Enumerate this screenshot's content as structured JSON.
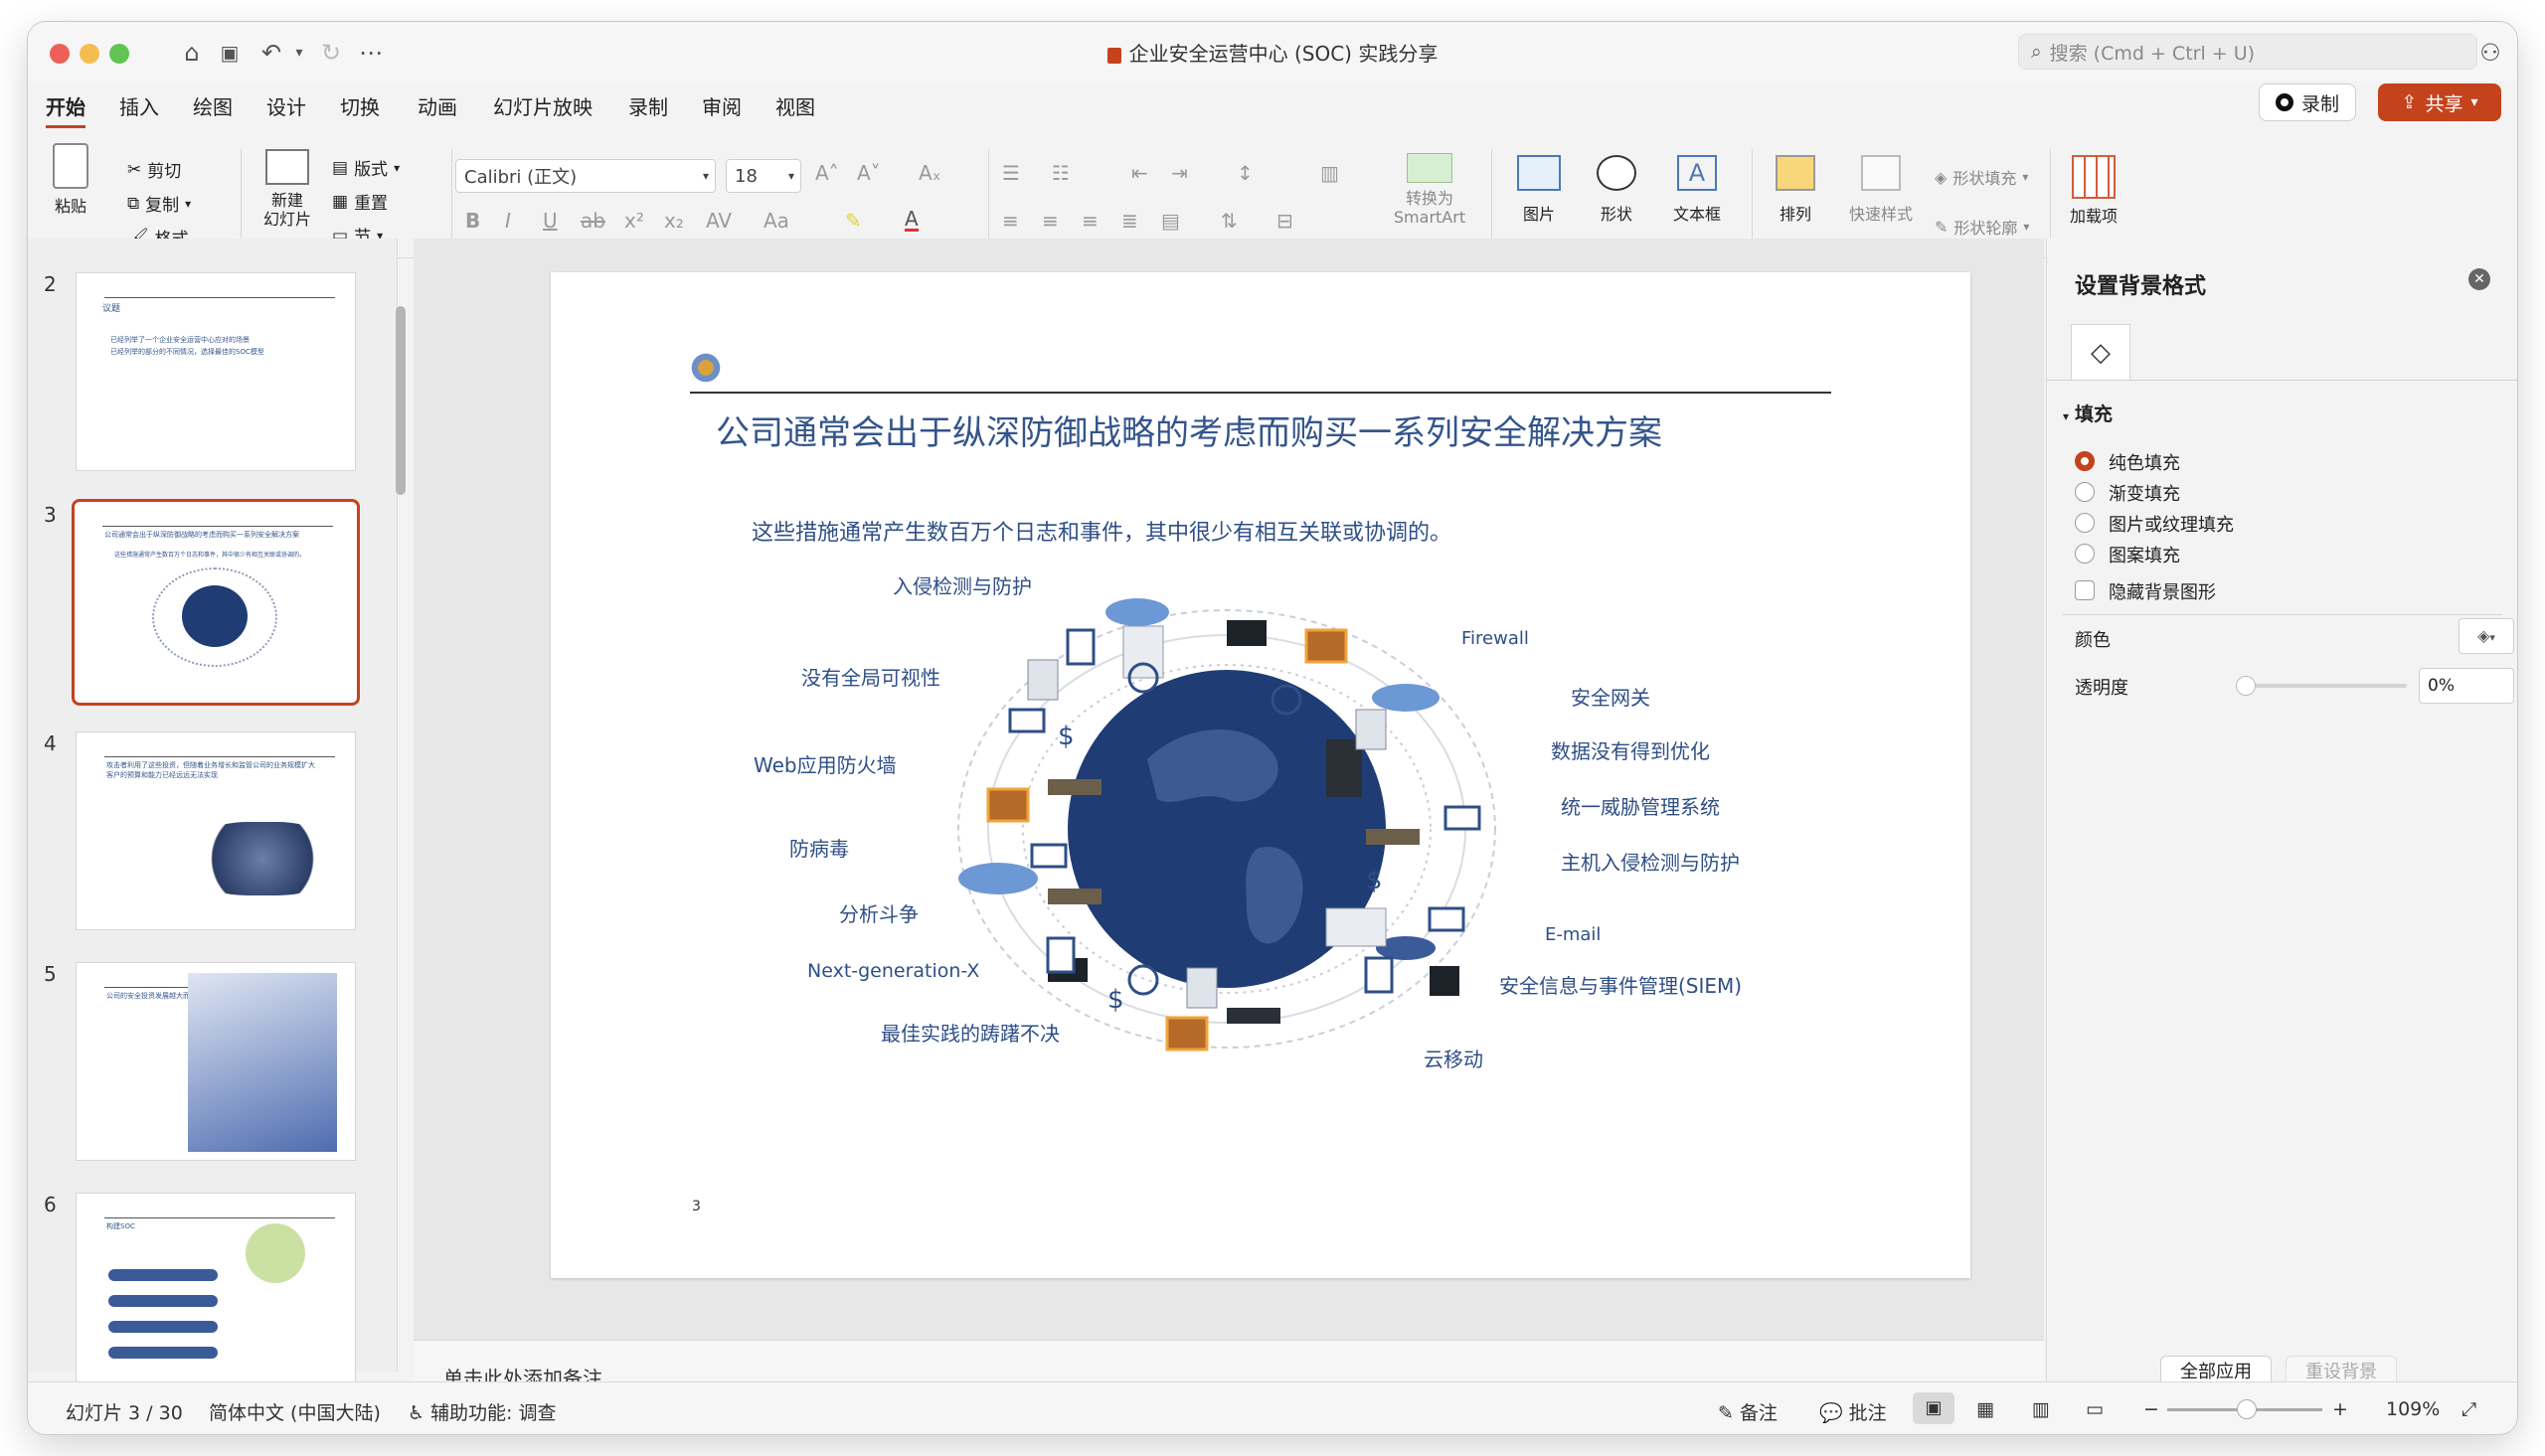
{
  "window": {
    "title": "企业安全运营中心 (SOC) 实践分享",
    "search_placeholder": "搜索 (Cmd + Ctrl + U)"
  },
  "tabs": [
    "开始",
    "插入",
    "绘图",
    "设计",
    "切换",
    "动画",
    "幻灯片放映",
    "录制",
    "审阅",
    "视图"
  ],
  "header_buttons": {
    "record": "录制",
    "share": "共享"
  },
  "ribbon": {
    "paste": "粘贴",
    "cut": "剪切",
    "copy": "复制",
    "format": "格式",
    "new_slide": "新建\n幻灯片",
    "layout": "版式",
    "reset": "重置",
    "section": "节",
    "font_name": "Calibri (正文)",
    "font_size": "18",
    "convert_smartart": "转换为\nSmartArt",
    "picture": "图片",
    "shape": "形状",
    "textbox": "文本框",
    "arrange": "排列",
    "quick_styles": "快速样式",
    "shape_fill": "形状填充",
    "shape_outline": "形状轮廓",
    "addins": "加载项"
  },
  "thumbnails": [
    {
      "number": "2",
      "title": "议题",
      "lines": [
        "已经列举了一个企业安全运营中心应对的场景",
        "已经列举的部分的不同情况，选择最佳的SOC模型"
      ]
    },
    {
      "number": "3",
      "title": "公司通常会出于纵深防御战略的考虑而购买一系列安全解决方案",
      "lines": [
        "这些措施通常产生数百万个日志和事件，其中很少有相互关联或协调的。"
      ]
    },
    {
      "number": "4",
      "title": "攻击者利用了这些投资，但随着业务增长和监管公司的业务规模扩大",
      "lines": [
        "客户的预算和能力已经远远无法实现"
      ]
    },
    {
      "number": "5",
      "title": "公司的安全投资发展越大而越",
      "lines": []
    },
    {
      "number": "6",
      "title": "构建SOC",
      "lines": []
    }
  ],
  "slide": {
    "title": "公司通常会出于纵深防御战略的考虑而购买一系列安全解决方案",
    "subtitle": "这些措施通常产生数百万个日志和事件，其中很少有相互关联或协调的。",
    "page_number": "3",
    "labels_left": [
      "入侵检测与防护",
      "没有全局可视性",
      "Web应用防火墙",
      "防病毒",
      "分析斗争",
      "Next-generation-X",
      "最佳实践的踌躇不决"
    ],
    "labels_right": [
      "Firewall",
      "安全网关",
      "数据没有得到优化",
      "统一威胁管理系统",
      "主机入侵检测与防护",
      "E-mail",
      "安全信息与事件管理(SIEM)",
      "云移动"
    ]
  },
  "notes_placeholder": "单击此处添加备注",
  "panel": {
    "title": "设置背景格式",
    "section_fill": "填充",
    "options": [
      "纯色填充",
      "渐变填充",
      "图片或纹理填充",
      "图案填充"
    ],
    "hide_bg": "隐藏背景图形",
    "color_label": "颜色",
    "transparency_label": "透明度",
    "transparency_value": "0%",
    "apply_all": "全部应用",
    "reset_bg": "重设背景"
  },
  "status": {
    "slide_info": "幻灯片 3 / 30",
    "language": "简体中文 (中国大陆)",
    "accessibility": "辅助功能: 调查",
    "notes": "备注",
    "comments": "批注",
    "zoom": "109%"
  },
  "colors": {
    "accent": "#c4431d",
    "slide_title": "#34558b",
    "globe": "#1f3c74"
  }
}
